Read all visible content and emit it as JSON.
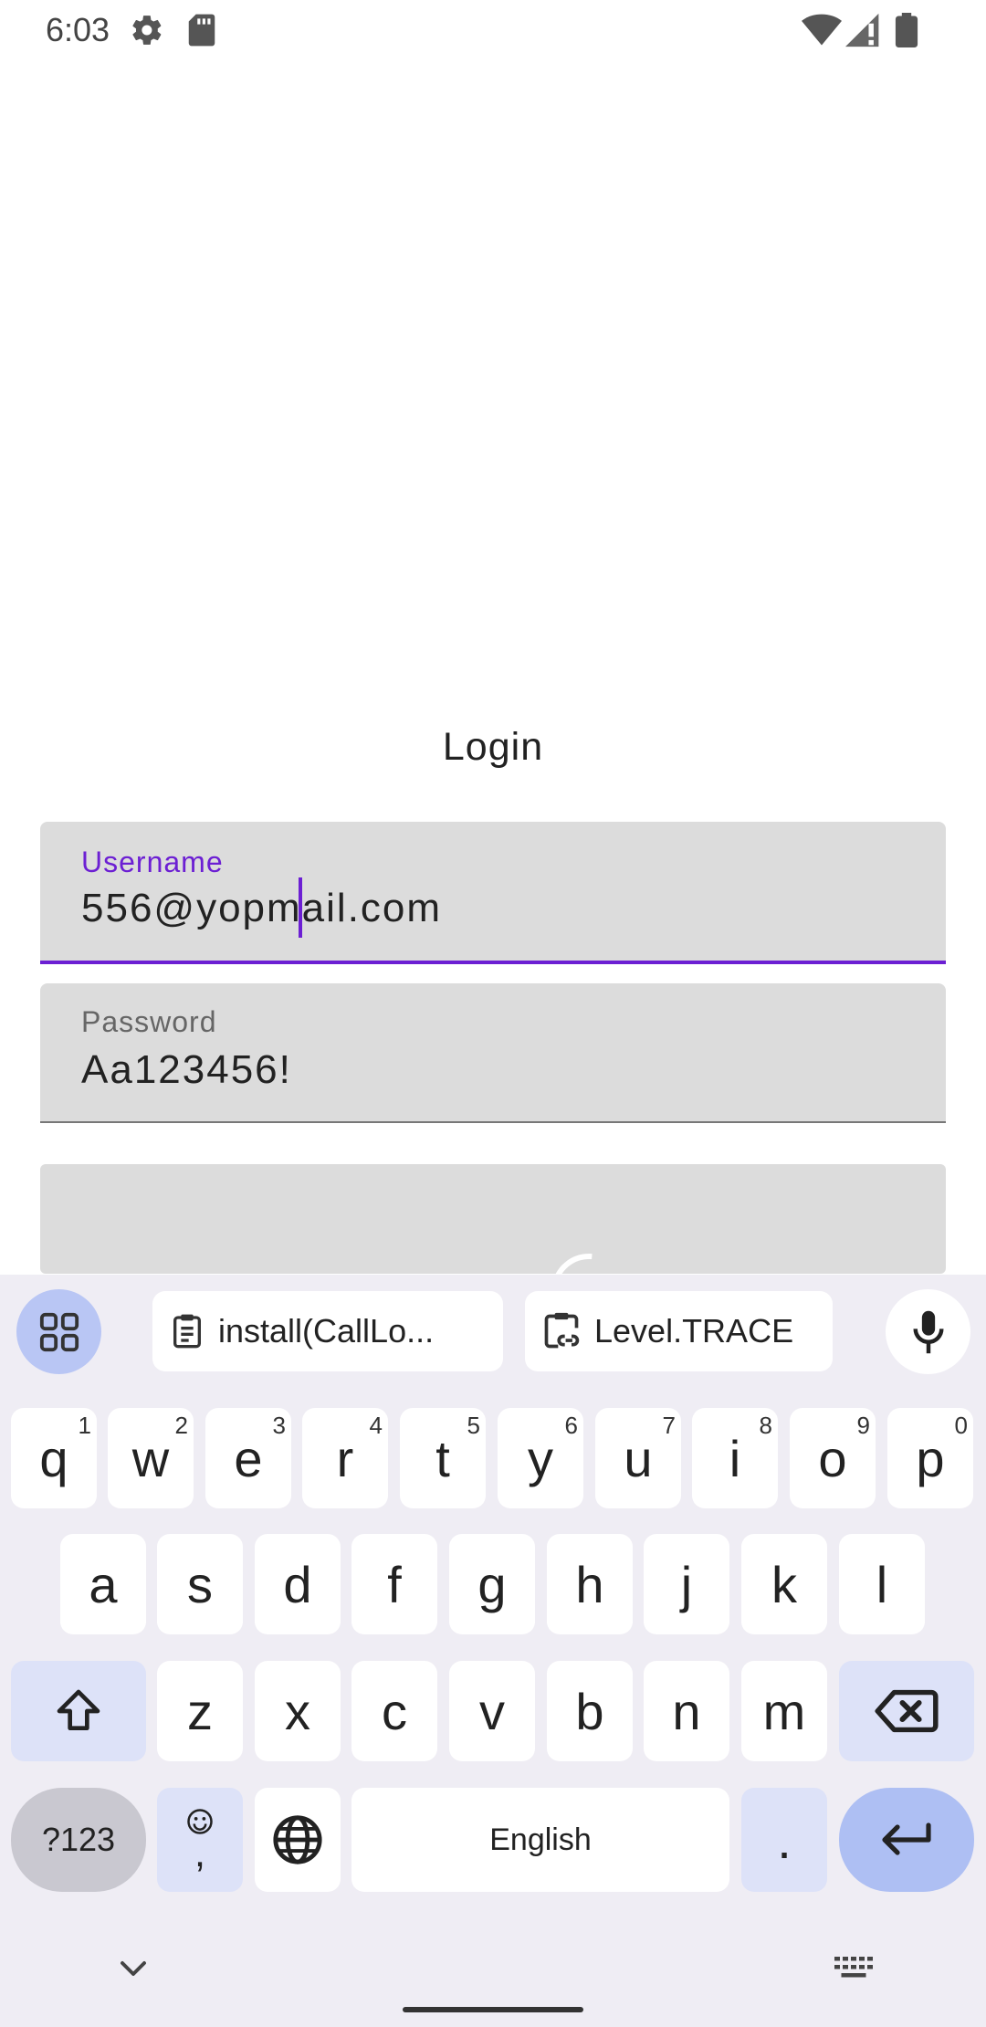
{
  "status": {
    "time": "6:03"
  },
  "login": {
    "title": "Login",
    "username": {
      "label": "Username",
      "value": "556@yopmail.com"
    },
    "password": {
      "label": "Password",
      "value": "Aa123456!"
    }
  },
  "keyboard": {
    "suggestions": [
      "install(CallLo...",
      "Level.TRACE"
    ],
    "row1": [
      {
        "k": "q",
        "n": "1"
      },
      {
        "k": "w",
        "n": "2"
      },
      {
        "k": "e",
        "n": "3"
      },
      {
        "k": "r",
        "n": "4"
      },
      {
        "k": "t",
        "n": "5"
      },
      {
        "k": "y",
        "n": "6"
      },
      {
        "k": "u",
        "n": "7"
      },
      {
        "k": "i",
        "n": "8"
      },
      {
        "k": "o",
        "n": "9"
      },
      {
        "k": "p",
        "n": "0"
      }
    ],
    "row2": [
      "a",
      "s",
      "d",
      "f",
      "g",
      "h",
      "j",
      "k",
      "l"
    ],
    "row3": [
      "z",
      "x",
      "c",
      "v",
      "b",
      "n",
      "m"
    ],
    "symbols_label": "?123",
    "emoji_comma": ",",
    "space_label": "English",
    "period": "."
  },
  "colors": {
    "accent": "#6c1fd3",
    "field_bg": "#dcdcdc",
    "keyboard_bg": "#efedf4"
  }
}
